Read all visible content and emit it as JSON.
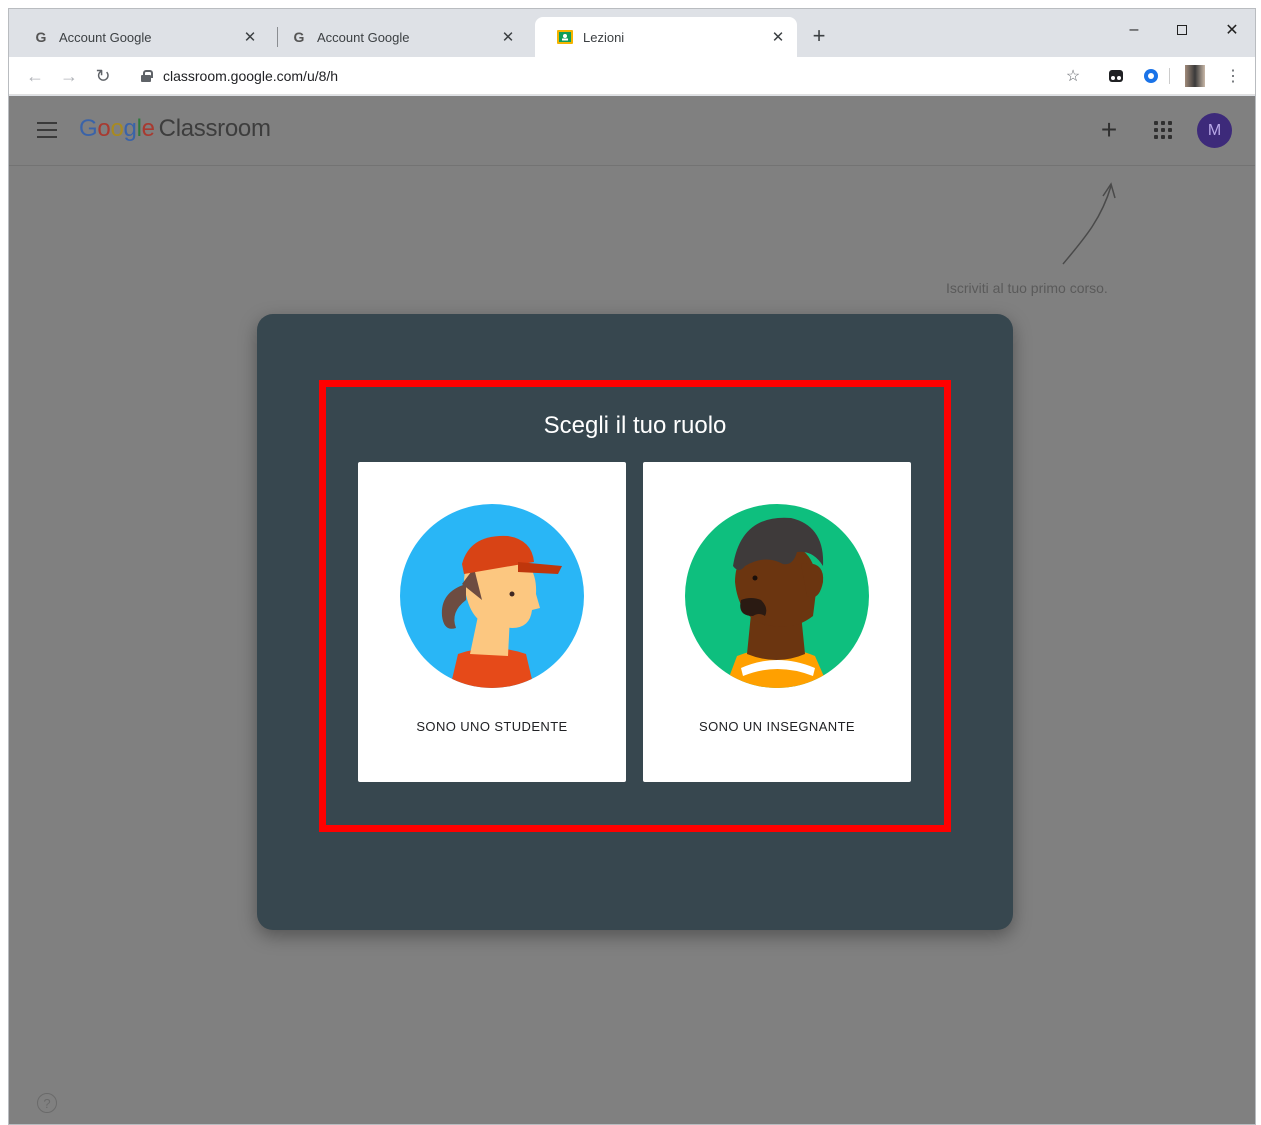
{
  "browser": {
    "tabs": [
      {
        "title": "Account Google",
        "icon": "google-g-icon"
      },
      {
        "title": "Account Google",
        "icon": "google-g-icon"
      },
      {
        "title": "Lezioni",
        "icon": "classroom-icon"
      }
    ],
    "url": "classroom.google.com/u/8/h"
  },
  "app": {
    "logo_google": "Google",
    "logo_product": "Classroom",
    "avatar_initial": "M",
    "hint": "Iscriviti al tuo primo corso."
  },
  "dialog": {
    "title": "Scegli il tuo ruolo",
    "student_label": "SONO UNO STUDENTE",
    "teacher_label": "SONO UN INSEGNANTE"
  },
  "colors": {
    "dialog_bg": "#37474f",
    "highlight": "#ff0000",
    "overlay": "#808080"
  }
}
